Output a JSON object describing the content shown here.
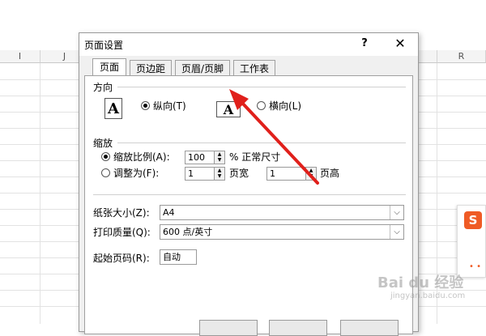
{
  "spreadsheet": {
    "columns": [
      "I",
      "J",
      "R"
    ]
  },
  "dialog": {
    "title": "页面设置",
    "help": "?",
    "close": "✕",
    "tabs": [
      "页面",
      "页边距",
      "页眉/页脚",
      "工作表"
    ],
    "orientation": {
      "label": "方向",
      "portrait_label": "纵向(T)",
      "landscape_label": "横向(L)",
      "portrait_icon": "A",
      "landscape_icon": "A",
      "selected": "portrait"
    },
    "scaling": {
      "label": "缩放",
      "adjust_label": "缩放比例(A):",
      "adjust_value": "100",
      "adjust_unit": "% 正常尺寸",
      "fit_label": "调整为(F):",
      "fit_wide_value": "1",
      "fit_wide_unit": "页宽",
      "fit_tall_value": "1",
      "fit_tall_unit": "页高",
      "selected": "adjust"
    },
    "paper_size": {
      "label": "纸张大小(Z):",
      "value": "A4"
    },
    "print_quality": {
      "label": "打印质量(Q):",
      "value": "600 点/英寸"
    },
    "first_page": {
      "label": "起始页码(R):",
      "value": "自动"
    }
  },
  "overlay": {
    "sogou_letter": "S",
    "watermark": "Bai du 经验",
    "watermark_sub": "jingyan.baidu.com",
    "arrow_color": "#e0201b"
  }
}
